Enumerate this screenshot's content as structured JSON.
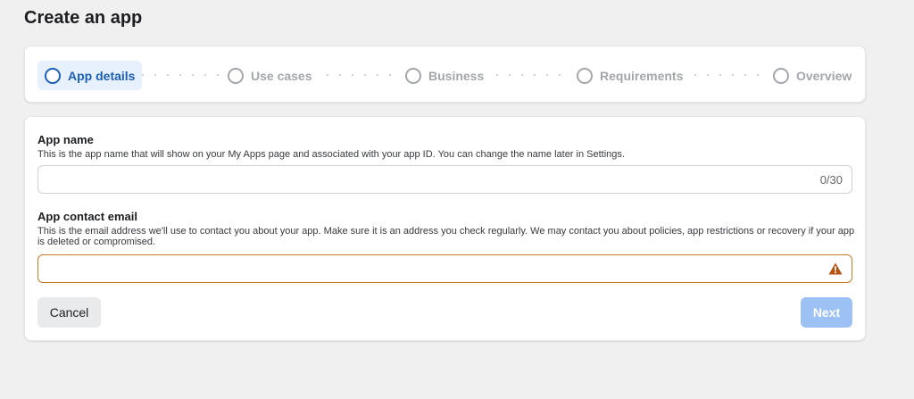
{
  "page": {
    "title": "Create an app"
  },
  "stepper": {
    "steps": [
      {
        "label": "App details",
        "state": "active"
      },
      {
        "label": "Use cases",
        "state": "inactive"
      },
      {
        "label": "Business",
        "state": "inactive"
      },
      {
        "label": "Requirements",
        "state": "inactive"
      },
      {
        "label": "Overview",
        "state": "inactive"
      }
    ]
  },
  "form": {
    "app_name": {
      "label": "App name",
      "description": "This is the app name that will show on your My Apps page and associated with your app ID. You can change the name later in Settings.",
      "value": "",
      "counter": "0/30"
    },
    "contact_email": {
      "label": "App contact email",
      "description": "This is the email address we'll use to contact you about your app. Make sure it is an address you check regularly. We may contact you about policies, app restrictions or recovery if your app is deleted or compromised.",
      "value": "",
      "status_icon": "warning-icon"
    }
  },
  "buttons": {
    "cancel": "Cancel",
    "next": "Next"
  },
  "colors": {
    "accent": "#1b5fb8",
    "active_step_bg": "#e7f0fd",
    "warning": "#b5500f",
    "next_disabled": "#9cc1f5"
  }
}
